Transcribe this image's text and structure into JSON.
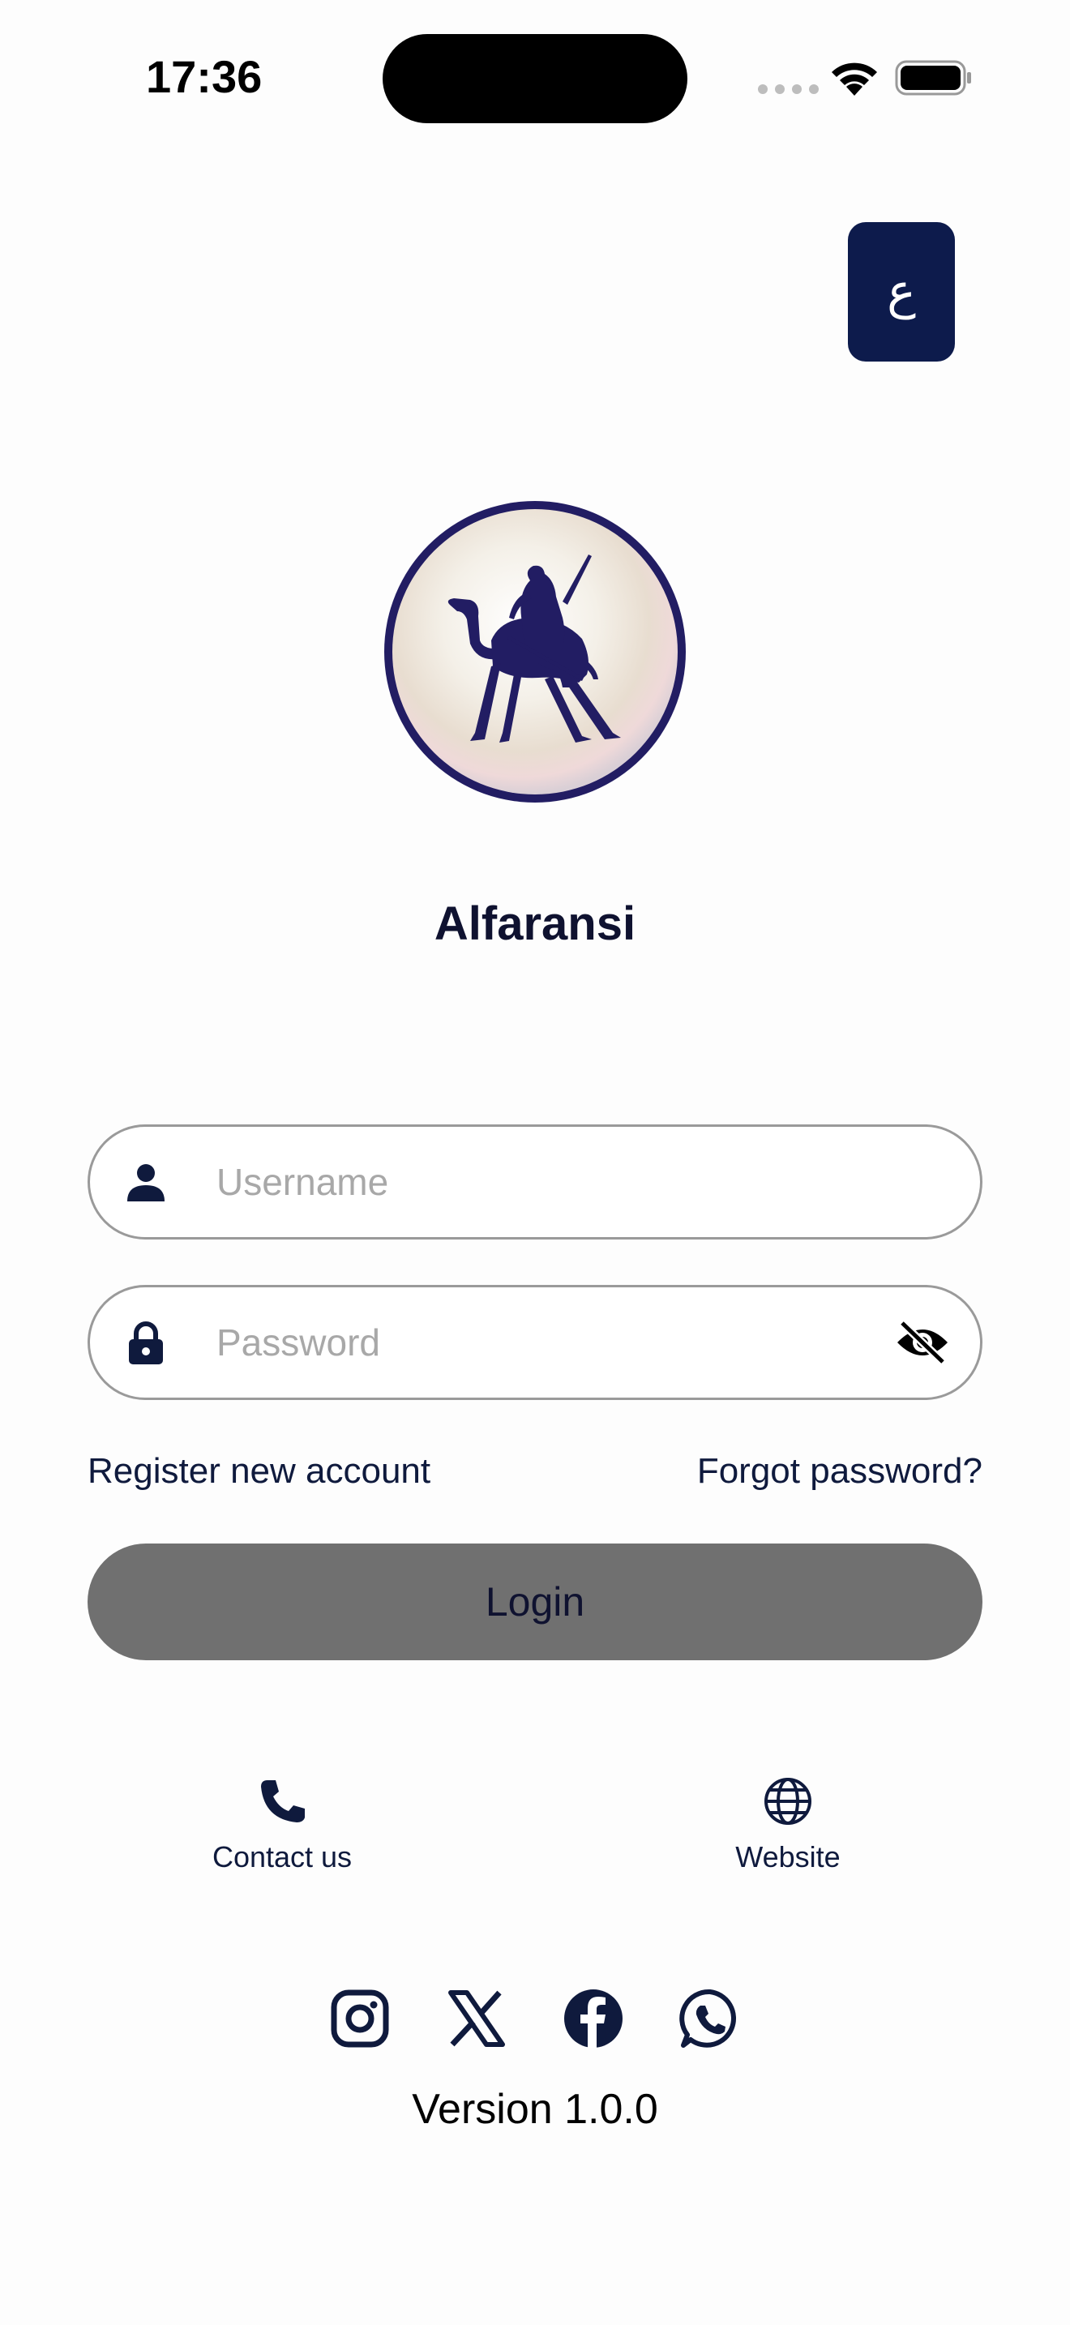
{
  "status_bar": {
    "time": "17:36"
  },
  "language_button": {
    "label": "ع"
  },
  "brand": {
    "name": "Alfaransi"
  },
  "login_form": {
    "username_placeholder": "Username",
    "password_placeholder": "Password",
    "register_label": "Register new account",
    "forgot_label": "Forgot password?",
    "login_label": "Login"
  },
  "quick_links": {
    "contact_label": "Contact us",
    "website_label": "Website"
  },
  "social_icons": [
    "instagram-icon",
    "x-icon",
    "facebook-icon",
    "whatsapp-icon"
  ],
  "footer": {
    "version": "Version 1.0.0"
  },
  "colors": {
    "primary": "#0d1b4c",
    "login_button": "#707070",
    "input_border": "#9a9a9a",
    "placeholder": "#a8a8a8",
    "logo_ring": "#221d63"
  }
}
